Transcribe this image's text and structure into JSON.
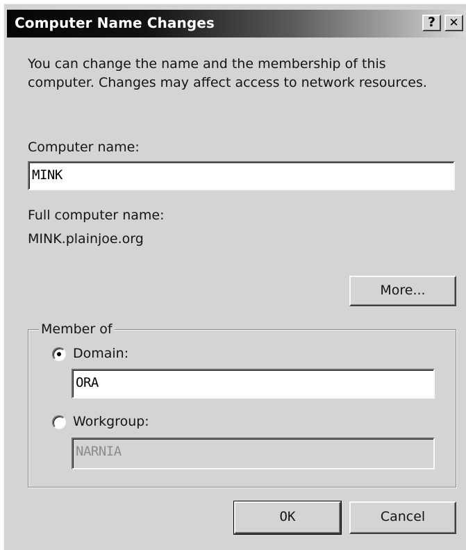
{
  "window": {
    "title": "Computer Name Changes",
    "help_label": "?",
    "close_label": "✕"
  },
  "intro": {
    "line1": "You can change the name and the membership of this",
    "line2": "computer. Changes may affect access to network resources."
  },
  "computer_name": {
    "label": "Computer name:",
    "value": "MINK"
  },
  "full_name": {
    "label": "Full computer name:",
    "value": "MINK.plainjoe.org"
  },
  "more_button": "More...",
  "member_of": {
    "label": "Member of",
    "domain": {
      "label": "Domain:",
      "value": "ORA",
      "selected": true
    },
    "workgroup": {
      "label": "Workgroup:",
      "value": "NARNIA",
      "selected": false
    }
  },
  "buttons": {
    "ok": "OK",
    "cancel": "Cancel"
  }
}
